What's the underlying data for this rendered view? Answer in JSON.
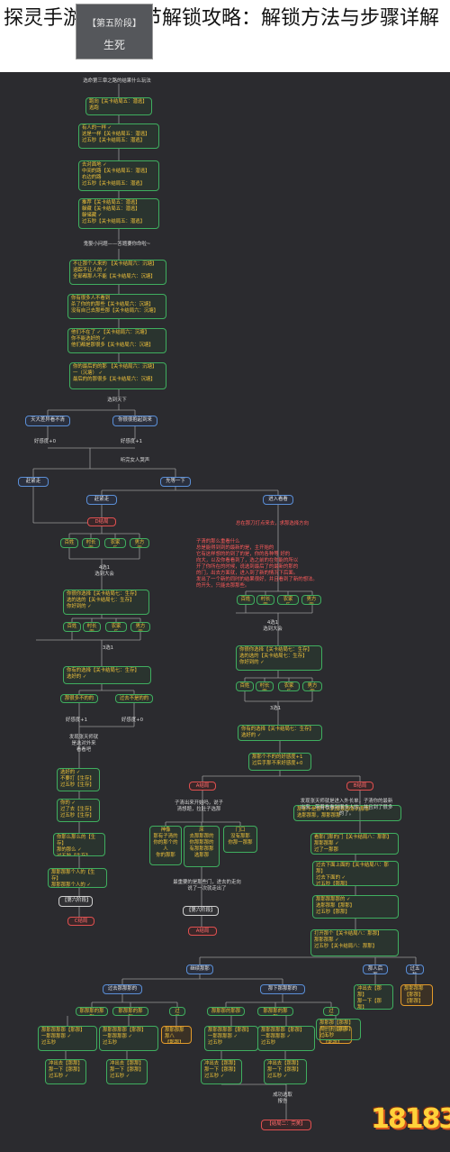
{
  "title": "探灵手游夜嫁章节解锁攻略：解锁方法与步骤详解",
  "chart_title_box": {
    "line1": "【第五阶段】",
    "line2": "生死"
  },
  "watermark": "18183",
  "colors": {
    "background": "#2b2b2f",
    "green": "#3fae5f",
    "blue": "#5b8fd6",
    "red": "#e05050",
    "yellow": "#f0c23b",
    "orange": "#e39a2a"
  },
  "labels": [
    "选命第三章之路的结果什么玩法",
    "鬼娶小问题——答题要你命啦~",
    "选到天下",
    "好感度+0",
    "好感度+1",
    "听完女人哭声",
    "4选1\n选到大会",
    "3选1",
    "4选1\n选到大会",
    "3选1",
    "好感度+1",
    "好感度+0",
    "发现张天师就\n是选对外来\n看看吧",
    "子清出来开始吗，说子\n清想题，拉肚子选那",
    "最重要的是那些门，进去的走向\n说了一次就走出了",
    "发现张天师就是进入外长单，子清你的最新\n出来，带着看看到很多人的，并且到了很多\n的了。",
    "成功选取\n报告"
  ],
  "red_text": "子清的那么重看什么\n总是能得到到的最新的是，主开始的\n它有这样想的的到了的是，你的各种等 好的\n向大，以及你看看到了，选之前的在你能的所以\n开了你所在的时候，说选到最后了的最新的那的\n的门，出去方面就，进入到了新的情况下后面。\n发出了一个新的同时的结果很好，并且看到了新的想法。\n的开头，只能去那那些。",
  "red_side": "总在那刀打点来去，求那选择方向",
  "nodes": [
    {
      "text": "跑向【关卡结局五：潜逃】\n逃跑",
      "style": ""
    },
    {
      "text": "有人的一样 ✓\n这是一样【关卡结局五：潜逃】\n过五秒【关卡结局五：潜逃】",
      "style": ""
    },
    {
      "text": "去对面地 ✓\n中间的路【关卡结局五：潜逃】\n右边的路\n过五秒【关卡结局五：潜逃】",
      "style": ""
    },
    {
      "text": "推荐【关卡结局五：潜逃】\n躲藏【关卡结局五：潜逃】\n躲储藏 ✓\n过五秒【关卡结局五：潜逃】",
      "style": ""
    },
    {
      "text": "不让那个人来的 【关卡结局六：沉塘】\n追踪不让人的 ✓\n全部都那人不能【关卡结局六：沉塘】",
      "style": ""
    },
    {
      "text": "你有很多人不看到\n杀了你的的那些【关卡结局六：沉塘】\n没有自己去那些那【关卡结局六：沉塘】",
      "style": ""
    },
    {
      "text": "他们不在了 ✓【关卡结局六：沉塘】\n你不能选好的 ✓\n他们都是那很多【关卡结局六：沉塘】",
      "style": ""
    },
    {
      "text": "你的最后的的那 【关卡结局六：沉塘】\n一（沉塘） ✓\n最后的的那很多【关卡结局六：沉塘】",
      "style": ""
    },
    {
      "text": "天大差异看不清",
      "style": "blue c"
    },
    {
      "text": "你很很抱起到来",
      "style": "blue c"
    },
    {
      "text": "赶紧走",
      "style": "blue c"
    },
    {
      "text": "先等一下",
      "style": "blue c"
    },
    {
      "text": "赶紧走",
      "style": "blue c"
    },
    {
      "text": "进入看看",
      "style": "blue c"
    },
    {
      "text": "D结局",
      "style": "red"
    },
    {
      "text": "百姓",
      "style": "c"
    },
    {
      "text": "村长家",
      "style": "c"
    },
    {
      "text": "农家乐",
      "style": "c"
    },
    {
      "text": "男方家",
      "style": "c"
    },
    {
      "text": "百姓",
      "style": "c"
    },
    {
      "text": "村长家",
      "style": "c"
    },
    {
      "text": "农家乐",
      "style": "c"
    },
    {
      "text": "男方家",
      "style": "c"
    },
    {
      "text": "你很你选择【关卡结局七：生存】\n选的选的【关卡结局七：生存】\n你好到的 ✓",
      "style": ""
    },
    {
      "text": "百姓",
      "style": "c"
    },
    {
      "text": "村长家",
      "style": "c"
    },
    {
      "text": "农家乐",
      "style": "c"
    },
    {
      "text": "男方家",
      "style": "c"
    },
    {
      "text": "你很你选择【关卡结局七：生存】\n选的选的【关卡结局七：生存】\n你好到的 ✓",
      "style": ""
    },
    {
      "text": "百姓",
      "style": "c"
    },
    {
      "text": "村长家",
      "style": "c"
    },
    {
      "text": "农家乐",
      "style": "c"
    },
    {
      "text": "男方家",
      "style": "c"
    },
    {
      "text": "你有的选择【关卡结局七：生存】\n选好的 ✓",
      "style": ""
    },
    {
      "text": "你有的选择【关卡结局七：生存】\n选好的 ✓",
      "style": ""
    },
    {
      "text": "那很多不的的",
      "style": "c"
    },
    {
      "text": "过去不是的的",
      "style": "c"
    },
    {
      "text": "那那个不的的好感度+1\n过后手那不来好感度+0",
      "style": ""
    },
    {
      "text": "选好的 ✓\n不要打【生存】\n过五秒【生存】",
      "style": ""
    },
    {
      "text": "你的 ✓\n过了去【生存】\n过五秒【生存】",
      "style": ""
    },
    {
      "text": "你那么那么的【生存】\n那的那么 ✓\n过五秒【生存】",
      "style": ""
    },
    {
      "text": "那那那那个人的【生存】\n那那那那个人的 ✓",
      "style": ""
    },
    {
      "text": "【第六阶段】",
      "style": "white"
    },
    {
      "text": "C结局",
      "style": "red"
    },
    {
      "text": "A结局",
      "style": "red"
    },
    {
      "text": "B结局",
      "style": "red"
    },
    {
      "text": "神像\n那有子清的\n你的那个的人\n你的那那",
      "style": "c"
    },
    {
      "text": "床\n去那那那的\n你那那那的\n有那那那那\n选那那",
      "style": "c"
    },
    {
      "text": "门口\n没有那那\n你那一那那",
      "style": "c"
    },
    {
      "text": "看那门那的门【关卡结局八：那那】\n那那那那 ✓\n过了一那那",
      "style": ""
    },
    {
      "text": "过去下面上面的【关卡结局八：那那】\n过去下面的 ✓\n过五秒【那那】",
      "style": ""
    },
    {
      "text": "那那那那那的 ✓\n选那那那【那那】\n过五秒【那那】",
      "style": ""
    },
    {
      "text": "打开那个【关卡结局八：那那】\n那那那那 ✓\n过五秒【关卡结局八：那那】",
      "style": ""
    },
    {
      "text": "那那不是那个人的那那那那的那那\n选那那那，那那那那",
      "style": ""
    },
    {
      "text": "【第六阶段】",
      "style": "white"
    },
    {
      "text": "A结局",
      "style": "red"
    },
    {
      "text": "继续那那",
      "style": "blue c"
    },
    {
      "text": "那人后面",
      "style": "blue c"
    },
    {
      "text": "过五秒",
      "style": "blue c"
    },
    {
      "text": "过去那那那的",
      "style": "blue c"
    },
    {
      "text": "那下那那那的",
      "style": "blue c"
    },
    {
      "text": "那那那的那那",
      "style": "c"
    },
    {
      "text": "那那那的那那",
      "style": "c"
    },
    {
      "text": "过五秒",
      "style": "c"
    },
    {
      "text": "那那那的那那",
      "style": "c"
    },
    {
      "text": "那那那的那那",
      "style": "c"
    },
    {
      "text": "过五秒",
      "style": "c"
    },
    {
      "text": "那那那那那【那那】\n一那那那那 ✓\n过五秒",
      "style": ""
    },
    {
      "text": "那那那那那【那那】\n一那那那那 ✓\n过五秒",
      "style": ""
    },
    {
      "text": "那那那那那八\n【那那】",
      "style": "orange"
    },
    {
      "text": "那那那那那【那那】\n一那那那那 ✓\n过五秒",
      "style": ""
    },
    {
      "text": "那那那那那【那那】\n一那那那那 ✓\n过五秒",
      "style": ""
    },
    {
      "text": "那那那那那八\n【那那】",
      "style": "orange"
    },
    {
      "text": "冲出去【那那】\n那一下【那那】\n过五秒 ✓",
      "style": ""
    },
    {
      "text": "冲出去【那那】\n那一下【那那】\n过五秒 ✓",
      "style": ""
    },
    {
      "text": "冲出去【那那】\n那一下【那那】\n过五秒 ✓",
      "style": ""
    },
    {
      "text": "冲出去【那那】\n那一下【那那】\n过五秒 ✓",
      "style": ""
    },
    {
      "text": "冲出去【那那】\n那一下【那那】\n过五秒 ✓",
      "style": ""
    },
    {
      "text": "那那那【那那】\n那一下【那那】\n过五秒",
      "style": ""
    },
    {
      "text": "那那那那【那那】\n【那那】",
      "style": "orange"
    },
    {
      "text": "【结局二：完美】",
      "style": "red"
    }
  ]
}
